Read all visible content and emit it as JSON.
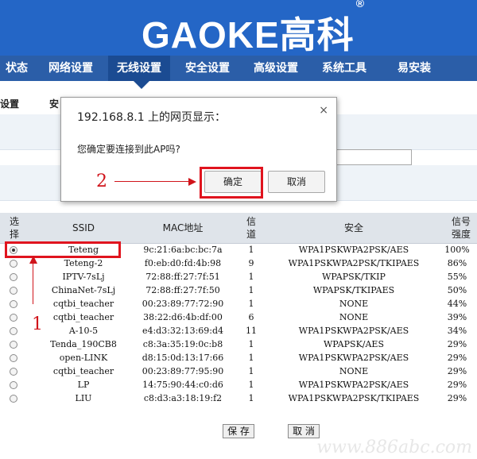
{
  "brand": {
    "logo_text": "GAOKE高科",
    "reg_mark": "®"
  },
  "nav": {
    "items": [
      {
        "label": "状态"
      },
      {
        "label": "网络设置"
      },
      {
        "label": "无线设置"
      },
      {
        "label": "安全设置"
      },
      {
        "label": "高级设置"
      },
      {
        "label": "系统工具"
      },
      {
        "label": "易安装"
      }
    ],
    "active_index": 2
  },
  "subnav": {
    "items": [
      {
        "label": "设置"
      },
      {
        "label": "安"
      }
    ]
  },
  "dialog": {
    "title": "192.168.8.1 上的网页显示：",
    "message": "您确定要连接到此AP吗?",
    "ok_label": "确定",
    "cancel_label": "取消",
    "close_glyph": "×"
  },
  "annotations": {
    "num1": "1",
    "num2": "2"
  },
  "table": {
    "headers": {
      "select": "选\n择",
      "ssid": "SSID",
      "mac": "MAC地址",
      "channel": "信\n道",
      "security": "安全",
      "signal": "信号\n强度"
    },
    "rows": [
      {
        "ssid": "Teteng",
        "mac": "9c:21:6a:bc:bc:7a",
        "channel": "1",
        "security": "WPA1PSKWPA2PSK/AES",
        "signal": "100%",
        "selected": true
      },
      {
        "ssid": "Teteng-2",
        "mac": "f0:eb:d0:fd:4b:98",
        "channel": "9",
        "security": "WPA1PSKWPA2PSK/TKIPAES",
        "signal": "86%"
      },
      {
        "ssid": "IPTV-7sLj",
        "mac": "72:88:ff:27:7f:51",
        "channel": "1",
        "security": "WPAPSK/TKIP",
        "signal": "55%"
      },
      {
        "ssid": "ChinaNet-7sLj",
        "mac": "72:88:ff:27:7f:50",
        "channel": "1",
        "security": "WPAPSK/TKIPAES",
        "signal": "50%"
      },
      {
        "ssid": "cqtbi_teacher",
        "mac": "00:23:89:77:72:90",
        "channel": "1",
        "security": "NONE",
        "signal": "44%"
      },
      {
        "ssid": "cqtbi_teacher",
        "mac": "38:22:d6:4b:df:00",
        "channel": "6",
        "security": "NONE",
        "signal": "39%"
      },
      {
        "ssid": "A-10-5",
        "mac": "e4:d3:32:13:69:d4",
        "channel": "11",
        "security": "WPA1PSKWPA2PSK/AES",
        "signal": "34%"
      },
      {
        "ssid": "Tenda_190CB8",
        "mac": "c8:3a:35:19:0c:b8",
        "channel": "1",
        "security": "WPAPSK/AES",
        "signal": "29%"
      },
      {
        "ssid": "open-LINK",
        "mac": "d8:15:0d:13:17:66",
        "channel": "1",
        "security": "WPA1PSKWPA2PSK/AES",
        "signal": "29%"
      },
      {
        "ssid": "cqtbi_teacher",
        "mac": "00:23:89:77:95:90",
        "channel": "1",
        "security": "NONE",
        "signal": "29%"
      },
      {
        "ssid": "LP",
        "mac": "14:75:90:44:c0:d6",
        "channel": "1",
        "security": "WPA1PSKWPA2PSK/AES",
        "signal": "29%"
      },
      {
        "ssid": "LIU",
        "mac": "c8:d3:a3:18:19:f2",
        "channel": "1",
        "security": "WPA1PSKWPA2PSK/TKIPAES",
        "signal": "29%"
      }
    ]
  },
  "buttons": {
    "save": "保 存",
    "cancel": "取 消"
  },
  "watermark": "www.886abc.com",
  "colors": {
    "banner": "#2466c6",
    "nav": "#2b5ea8",
    "annotation": "#d0141b"
  }
}
